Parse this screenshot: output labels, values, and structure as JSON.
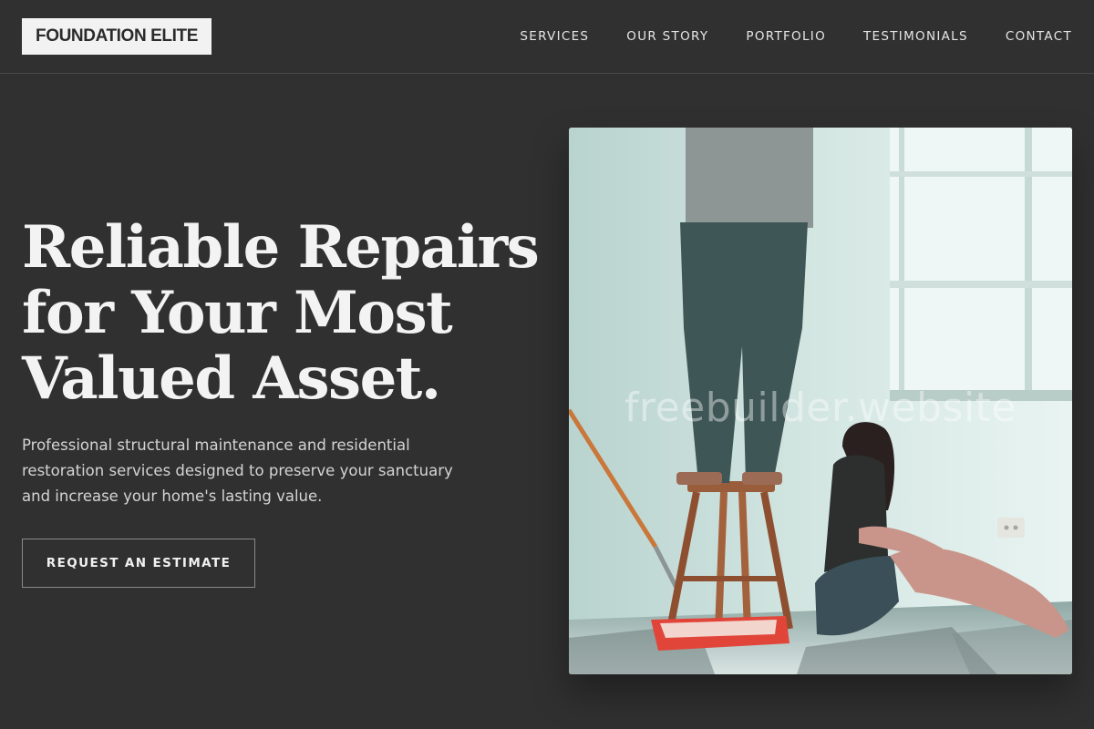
{
  "header": {
    "logo": "FOUNDATION ELITE",
    "nav": [
      "SERVICES",
      "OUR STORY",
      "PORTFOLIO",
      "TESTIMONIALS",
      "CONTACT"
    ]
  },
  "hero": {
    "title_lines": [
      "Reliable Repairs",
      "for Your Most",
      "Valued Asset."
    ],
    "description_lines": [
      "Professional structural maintenance and residential",
      "restoration services designed to preserve your sanctuary",
      "and increase your home's lasting value."
    ],
    "cta_label": "REQUEST AN ESTIMATE",
    "image": {
      "subject": "people-painting-room-photo",
      "watermark": "freebuilder.website"
    }
  },
  "colors": {
    "background": "#303030",
    "logo_bg": "#f2f2f2",
    "text": "#f1f1f1"
  }
}
